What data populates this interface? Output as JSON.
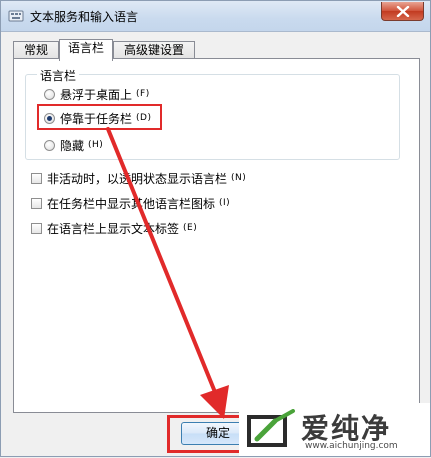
{
  "window": {
    "title": "文本服务和输入语言"
  },
  "tabs": [
    {
      "label": "常规"
    },
    {
      "label": "语言栏"
    },
    {
      "label": "高级键设置"
    }
  ],
  "language_bar": {
    "group_label": "语言栏",
    "radios": [
      {
        "label": "悬浮于桌面上",
        "shortcut": "(F)",
        "checked": false
      },
      {
        "label": "停靠于任务栏",
        "shortcut": "(D)",
        "checked": true
      },
      {
        "label": "隐藏",
        "shortcut": "(H)",
        "checked": false
      }
    ]
  },
  "checkboxes": [
    {
      "label": "非活动时，以透明状态显示语言栏",
      "shortcut": "(N)",
      "checked": false
    },
    {
      "label": "在任务栏中显示其他语言栏图标",
      "shortcut": "(I)",
      "checked": false
    },
    {
      "label": "在语言栏上显示文本标签",
      "shortcut": "(E)",
      "checked": false
    }
  ],
  "buttons": {
    "ok_label": "确定"
  },
  "watermark": {
    "name": "爱纯净",
    "url": "www.aichunjing.com"
  },
  "colors": {
    "highlight": "#e12a2a",
    "arrow": "#e12a2a"
  }
}
